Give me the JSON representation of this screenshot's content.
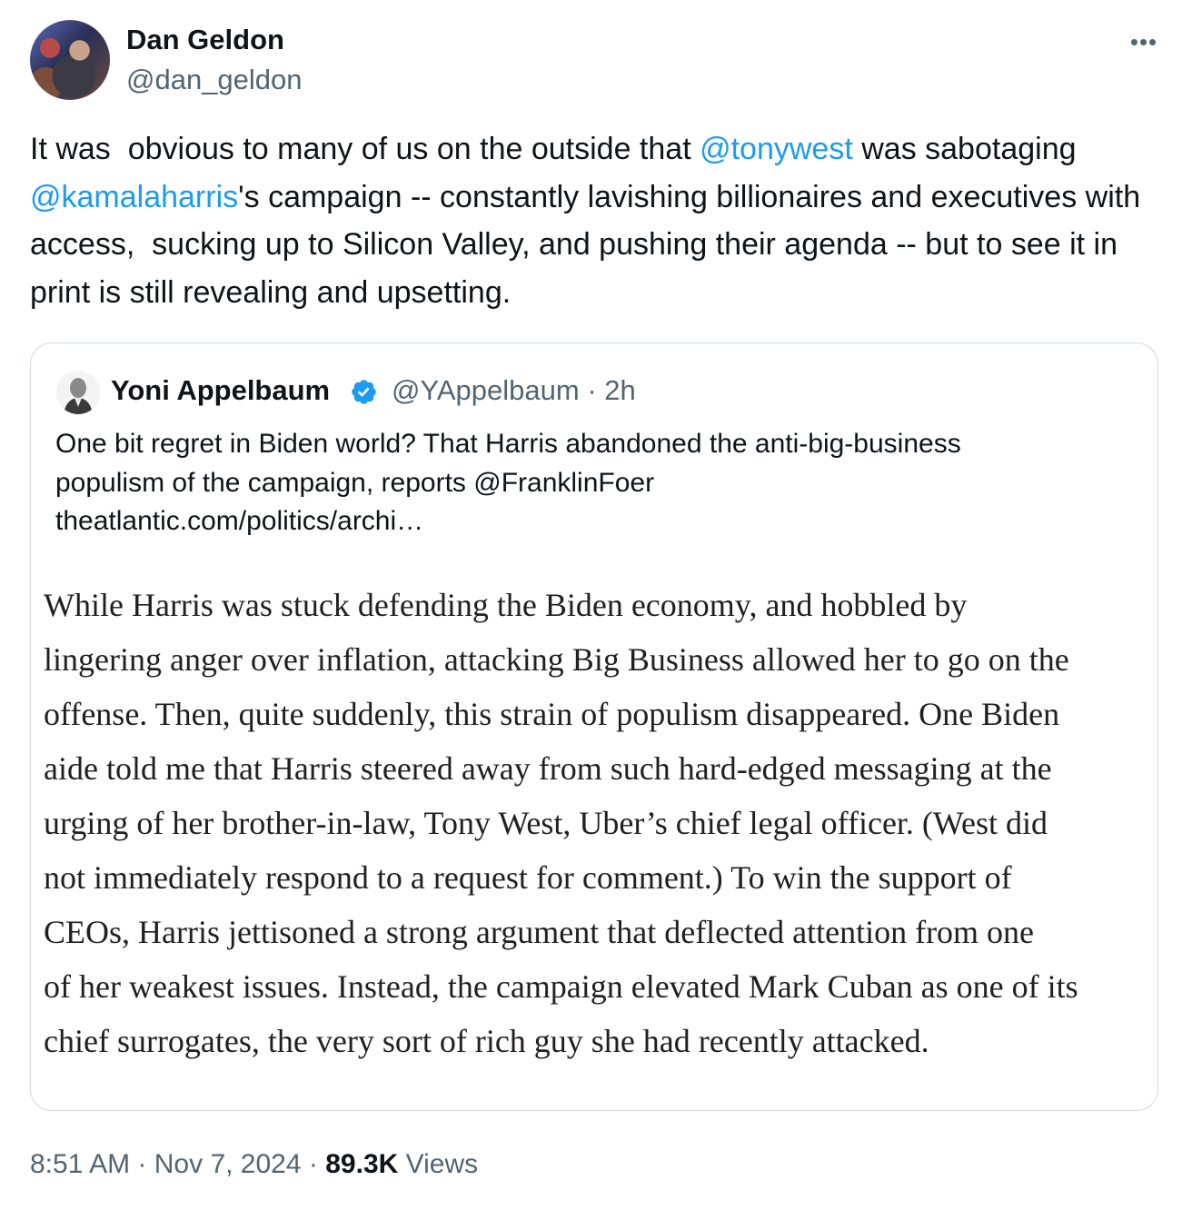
{
  "tweet": {
    "author": {
      "name": "Dan Geldon",
      "handle": "@dan_geldon"
    },
    "text_segments": [
      "It was  obvious to many of us on the outside that ",
      "@tonywest",
      " was sabotaging ",
      "@kamalaharris",
      "'s campaign -- constantly lavishing billionaires and executives with access,  sucking up to Silicon Valley, and pushing their agenda -- but to see it in print is still revealing and upsetting."
    ],
    "more_icon": "more-horizontal-icon",
    "link_color": "#1d9bf0"
  },
  "quote": {
    "author": {
      "name": "Yoni Appelbaum",
      "handle": "@YAppelbaum",
      "time": "2h",
      "separator": "·"
    },
    "verified_icon": "verified-badge-icon",
    "verified_color": "#1d9bf0",
    "text_lines": [
      "One bit regret in Biden world? That Harris abandoned the anti-big-business",
      "populism of the campaign, reports @FranklinFoer",
      "theatlantic.com/politics/archi…"
    ],
    "excerpt_lines": [
      "While Harris was stuck defending the Biden economy, and hobbled by",
      "lingering anger over inflation, attacking Big Business allowed her to go on the",
      "offense. Then, quite suddenly, this strain of populism disappeared. One Biden",
      "aide told me that Harris steered away from such hard-edged messaging at the",
      "urging of her brother-in-law, Tony West, Uber’s chief legal officer. (West did",
      "not immediately respond to a request for comment.) To win the support of",
      "CEOs, Harris jettisoned a strong argument that deflected attention from one",
      "of her weakest issues. Instead, the campaign elevated Mark Cuban as one of its",
      "chief surrogates, the very sort of rich guy she had recently attacked."
    ]
  },
  "footer": {
    "time": "8:51 AM",
    "separator": "·",
    "date": "Nov 7, 2024",
    "views_count": "89.3K",
    "views_label": "Views"
  }
}
